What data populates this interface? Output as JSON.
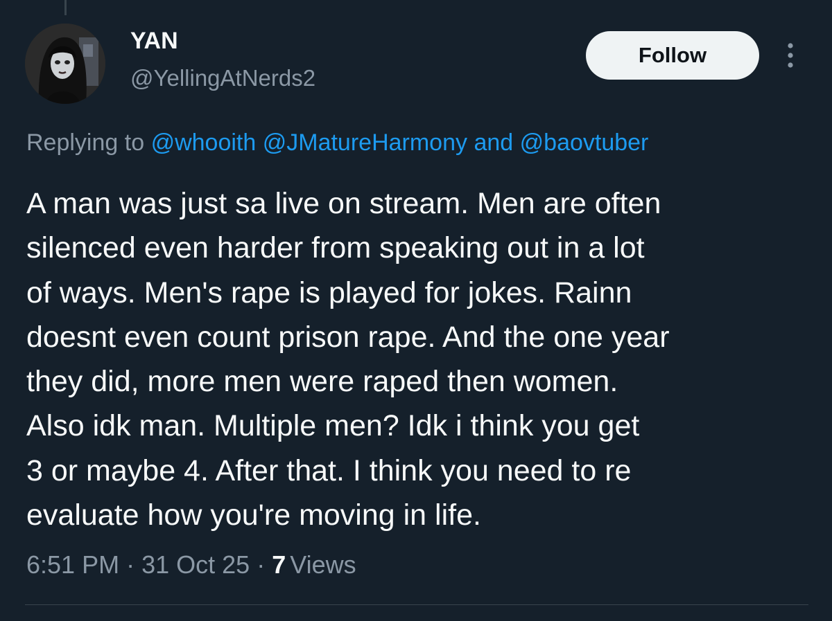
{
  "author": {
    "display_name": "YAN",
    "handle": "@YellingAtNerds2"
  },
  "actions": {
    "follow_label": "Follow",
    "more_icon": "more-vertical-icon"
  },
  "reply_context": {
    "prefix": "Replying to",
    "mentions": [
      "@whooith",
      "@JMatureHarmony",
      "@baovtuber"
    ],
    "conjunction": "and"
  },
  "tweet": {
    "lines": [
      "A man was just sa live on stream. Men are often",
      "silenced even harder from speaking out in a lot",
      "of ways. Men's rape is played for jokes. Rainn",
      "doesnt even count prison rape. And the one year",
      "they did, more men were raped then women.",
      "Also idk man. Multiple men? Idk i think you get",
      "3 or maybe 4. After that. I think you need to re",
      "evaluate how you're moving in life."
    ]
  },
  "meta": {
    "time": "6:51 PM",
    "separator": "·",
    "date": "31 Oct 25",
    "views_count": "7",
    "views_label": "Views"
  },
  "colors": {
    "background": "#15202b",
    "text_primary": "#f7f9f9",
    "text_secondary": "#8b98a5",
    "link": "#1d9bf0",
    "follow_button_bg": "#eff3f4"
  }
}
